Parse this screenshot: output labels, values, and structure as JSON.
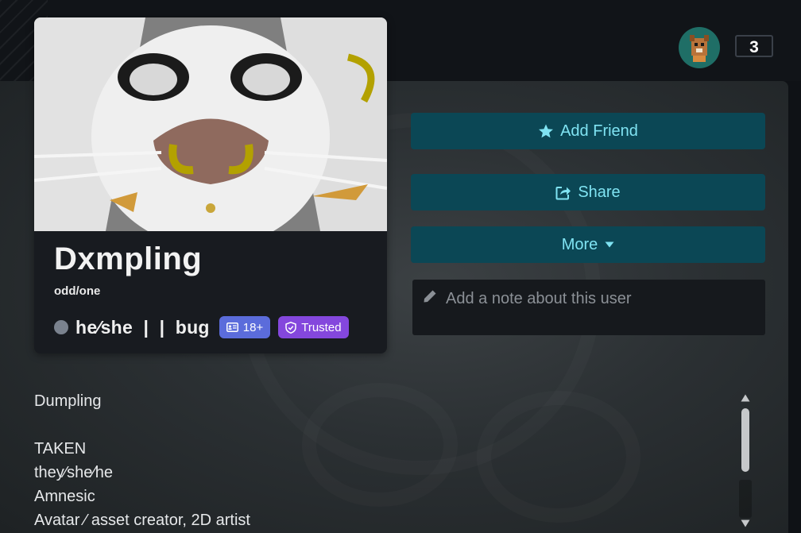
{
  "user": {
    "display_name": "Dxmpling",
    "status_description": "odd/one",
    "pronouns": "he⁄she  |  |  bug",
    "badges": {
      "age": "18+",
      "trust": "Trusted"
    },
    "nav_counter": "3"
  },
  "actions": {
    "add_friend": "Add Friend",
    "share": "Share",
    "more": "More"
  },
  "note": {
    "placeholder": "Add a note about this user"
  },
  "bio": {
    "lines": [
      "Dumpling",
      "",
      "TAKEN",
      "they⁄she⁄he",
      "Amnesic",
      "Avatar ⁄ asset creator, 2D artist"
    ]
  },
  "colors": {
    "button_bg": "#0b4755",
    "button_text": "#7fe3f2",
    "badge_age": "#5b6cdb",
    "badge_trusted": "#8447dd",
    "status_offline": "#7a828e"
  },
  "icons": {
    "add_friend": "star-icon",
    "share": "share-icon",
    "more": "caret-down-icon",
    "note": "pencil-icon",
    "age_badge": "id-card-icon",
    "trust_badge": "shield-icon"
  }
}
